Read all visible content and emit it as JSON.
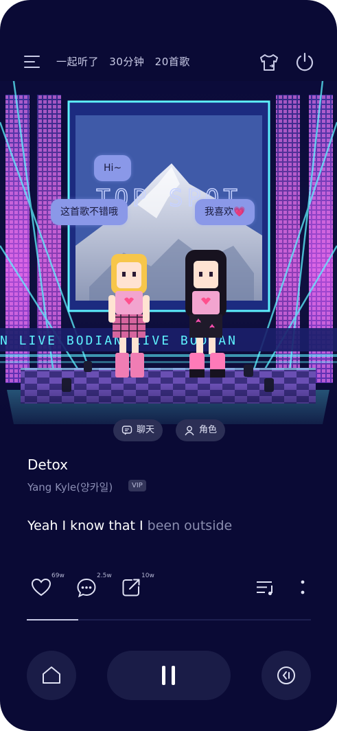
{
  "header": {
    "listen_together": "一起听了",
    "duration": "30分钟",
    "song_count": "20首歌"
  },
  "stage": {
    "screen_text": "TOP SPOT",
    "banner_text": "N LIVE     BODIAN LIVE     BODIAN",
    "bubbles": [
      "Hi~",
      "这首歌不错哦",
      "我喜欢💗"
    ]
  },
  "pills": {
    "chat": "聊天",
    "role": "角色"
  },
  "song": {
    "title": "Detox",
    "artist": "Yang Kyle(양카일)",
    "vip_badge": "VIP",
    "lyric_sung": "Yeah I know that I ",
    "lyric_pending": "been outside"
  },
  "actions": {
    "like_count": "69w",
    "comment_count": "2.5w",
    "share_count": "10w"
  },
  "playback": {
    "progress": 0.18
  },
  "colors": {
    "background": "#0a0a35",
    "bubble": "#8a98e8",
    "pink": "#ff4fb0",
    "cyan": "#5ef2ff"
  },
  "icons": [
    "menu-icon",
    "shirt-icon",
    "power-icon",
    "chat-icon",
    "person-icon",
    "heart-icon",
    "comment-icon",
    "share-icon",
    "playlist-icon",
    "more-icon",
    "home-icon",
    "pause-icon",
    "back-icon"
  ]
}
